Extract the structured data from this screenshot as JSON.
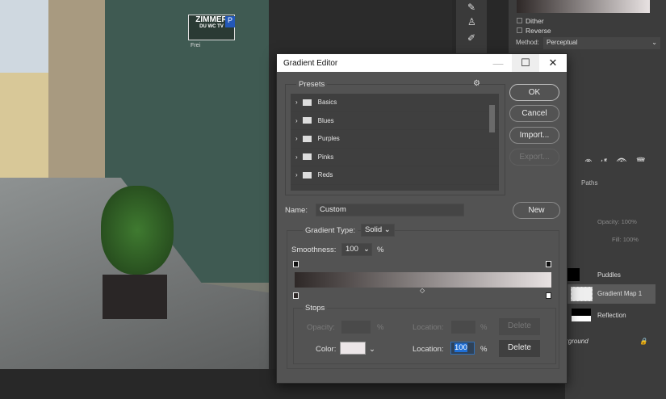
{
  "background": {
    "sign_text": "ZIMMER",
    "sign_sub": "DU WC TV",
    "sign_frei": "Frei",
    "sign_p": "P"
  },
  "properties": {
    "dither_label": "Dither",
    "reverse_label": "Reverse",
    "method_label": "Method:",
    "method_value": "Perceptual"
  },
  "layers": {
    "tab_paths": "Paths",
    "opacity_label": "Opacity:",
    "opacity_value": "100%",
    "fill_label": "Fill:",
    "fill_value": "100%",
    "items": [
      {
        "name": "Puddles"
      },
      {
        "name": "Gradient Map 1",
        "selected": true
      },
      {
        "name": "Reflection"
      },
      {
        "name": "Background",
        "locked": true
      }
    ]
  },
  "dialog": {
    "title": "Gradient Editor",
    "presets_label": "Presets",
    "presets": [
      "Basics",
      "Blues",
      "Purples",
      "Pinks",
      "Reds"
    ],
    "ok": "OK",
    "cancel": "Cancel",
    "import": "Import...",
    "export": "Export...",
    "name_label": "Name:",
    "name_value": "Custom",
    "new": "New",
    "gradient_type_label": "Gradient Type:",
    "gradient_type_value": "Solid",
    "smoothness_label": "Smoothness:",
    "smoothness_value": "100",
    "percent": "%",
    "gradient": {
      "start_color": "#2e2827",
      "end_color": "#e8e2e2"
    },
    "stops_label": "Stops",
    "opacity_label": "Opacity:",
    "location_label": "Location:",
    "delete": "Delete",
    "color_label": "Color:",
    "color_value": "#ece6e8",
    "location_value": "100"
  }
}
